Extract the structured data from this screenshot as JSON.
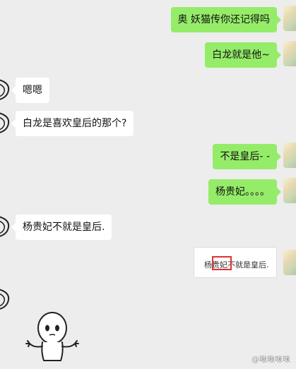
{
  "messages": [
    {
      "side": "sent",
      "text": "奥 妖猫传你还记得吗"
    },
    {
      "side": "sent",
      "text": "白龙就是他~"
    },
    {
      "side": "recv",
      "text": "嗯嗯"
    },
    {
      "side": "recv",
      "text": "白龙是喜欢皇后的那个?"
    },
    {
      "side": "sent",
      "text": "不是皇后- -"
    },
    {
      "side": "sent",
      "text": "杨贵妃。。。。"
    },
    {
      "side": "recv",
      "text": "杨贵妃不就是皇后."
    }
  ],
  "quote_image": {
    "text": "杨贵妃不就是皇后.",
    "highlight": "贵妃"
  },
  "watermark": "@啾啾咪咪"
}
